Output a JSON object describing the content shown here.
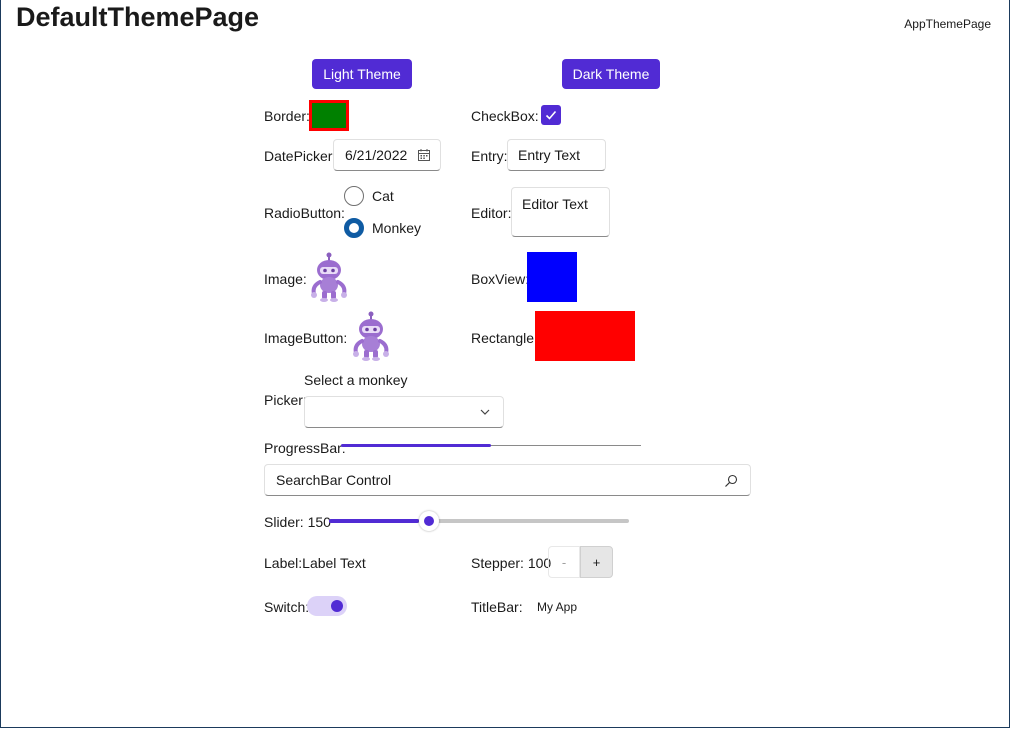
{
  "page": {
    "title": "DefaultThemePage",
    "app_theme_link": "AppThemePage"
  },
  "theme_buttons": {
    "light": "Light Theme",
    "dark": "Dark Theme"
  },
  "border": {
    "label": "Border:",
    "stroke_color": "#ff0000",
    "fill_color": "#008000"
  },
  "checkbox": {
    "label": "CheckBox:",
    "checked": true,
    "color": "#512bd4"
  },
  "datepicker": {
    "label": "DatePicker:",
    "value": "6/21/2022",
    "icon": "calendar-icon"
  },
  "entry": {
    "label": "Entry:",
    "value": "Entry Text"
  },
  "radiobutton": {
    "label": "RadioButton:",
    "options": [
      "Cat",
      "Monkey"
    ],
    "selected": "Monkey"
  },
  "editor": {
    "label": "Editor:",
    "value": "Editor Text"
  },
  "image": {
    "label": "Image:",
    "icon": "dotnet-bot-image"
  },
  "boxview": {
    "label": "BoxView:",
    "color": "#0000ff"
  },
  "imagebutton": {
    "label": "ImageButton:",
    "icon": "dotnet-bot-image"
  },
  "rectangle": {
    "label": "Rectangle:",
    "color": "#ff0000"
  },
  "picker": {
    "label": "Picker:",
    "title": "Select a monkey",
    "value": "",
    "icon": "chevron-down-icon"
  },
  "progressbar": {
    "label": "ProgressBar:",
    "progress": 0.5,
    "color": "#512bd4"
  },
  "searchbar": {
    "value": "SearchBar Control",
    "icon": "search-icon"
  },
  "slider": {
    "label": "Slider: 150",
    "value": 150,
    "min": 0,
    "max": 500,
    "color": "#512bd4"
  },
  "label_row": {
    "label": "Label:",
    "text": "Label Text"
  },
  "stepper": {
    "label": "Stepper: 100",
    "minus": "-",
    "plus": "+"
  },
  "switch": {
    "label": "Switch:",
    "on": true
  },
  "titlebar": {
    "label": "TitleBar:",
    "text": "My App"
  },
  "colors": {
    "accent": "#512bd4",
    "accent_light": "#dcd2f8"
  }
}
